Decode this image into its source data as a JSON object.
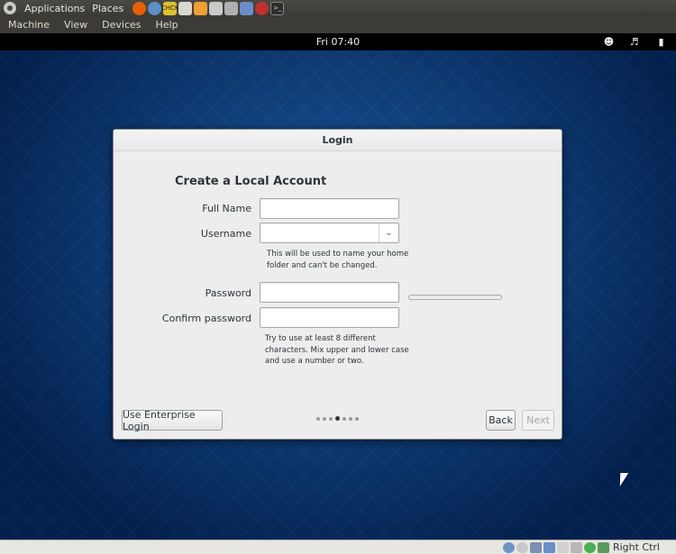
{
  "host_panel": {
    "menus": [
      "Applications",
      "Places"
    ],
    "launchers": [
      {
        "icon": "firefox-icon",
        "color": "#e66000"
      },
      {
        "icon": "thunderbird-icon",
        "color": "#5f8fc7"
      },
      {
        "icon": "checkgmail-icon",
        "color": "#e0c030",
        "text": "CHCK"
      },
      {
        "icon": "text-editor-icon",
        "color": "#d8d8d0"
      },
      {
        "icon": "folder-icon",
        "color": "#f0a030"
      },
      {
        "icon": "games-icon",
        "color": "#c9c9c9"
      },
      {
        "icon": "screenshot-icon",
        "color": "#b0b0b0"
      },
      {
        "icon": "virtualbox-icon",
        "color": "#6a8fc8"
      },
      {
        "icon": "app-icon",
        "color": "#c03030"
      },
      {
        "icon": "terminal-icon",
        "color": "#2e2e2e"
      }
    ]
  },
  "vm_menubar": {
    "items": [
      "Machine",
      "View",
      "Devices",
      "Help"
    ]
  },
  "guest_topbar": {
    "clock": "Fri 07:40",
    "icons": [
      "accessibility-icon",
      "volume-icon",
      "battery-icon"
    ]
  },
  "dialog": {
    "title": "Login",
    "heading": "Create a Local Account",
    "full_name": {
      "label": "Full Name",
      "value": ""
    },
    "username": {
      "label": "Username",
      "value": "",
      "hint": [
        "This will be used to name your home",
        "folder and can't be changed."
      ]
    },
    "password": {
      "label": "Password",
      "value": ""
    },
    "confirm_password": {
      "label": "Confirm password",
      "value": ""
    },
    "password_hint": [
      "Try to use at least 8 different",
      "characters. Mix upper and lower case",
      "and use a number or two."
    ],
    "password_strength": 0,
    "enterprise_button": "Use Enterprise Login",
    "back_button": "Back",
    "next_button": "Next",
    "pages": {
      "total": 7,
      "current": 4
    }
  },
  "host_status": {
    "host_key": "Right Ctrl",
    "icons": [
      "hard-disk-icon",
      "optical-drive-icon",
      "usb-icon",
      "shared-folders-icon",
      "display-icon",
      "network-icon",
      "mouse-integration-icon"
    ]
  }
}
